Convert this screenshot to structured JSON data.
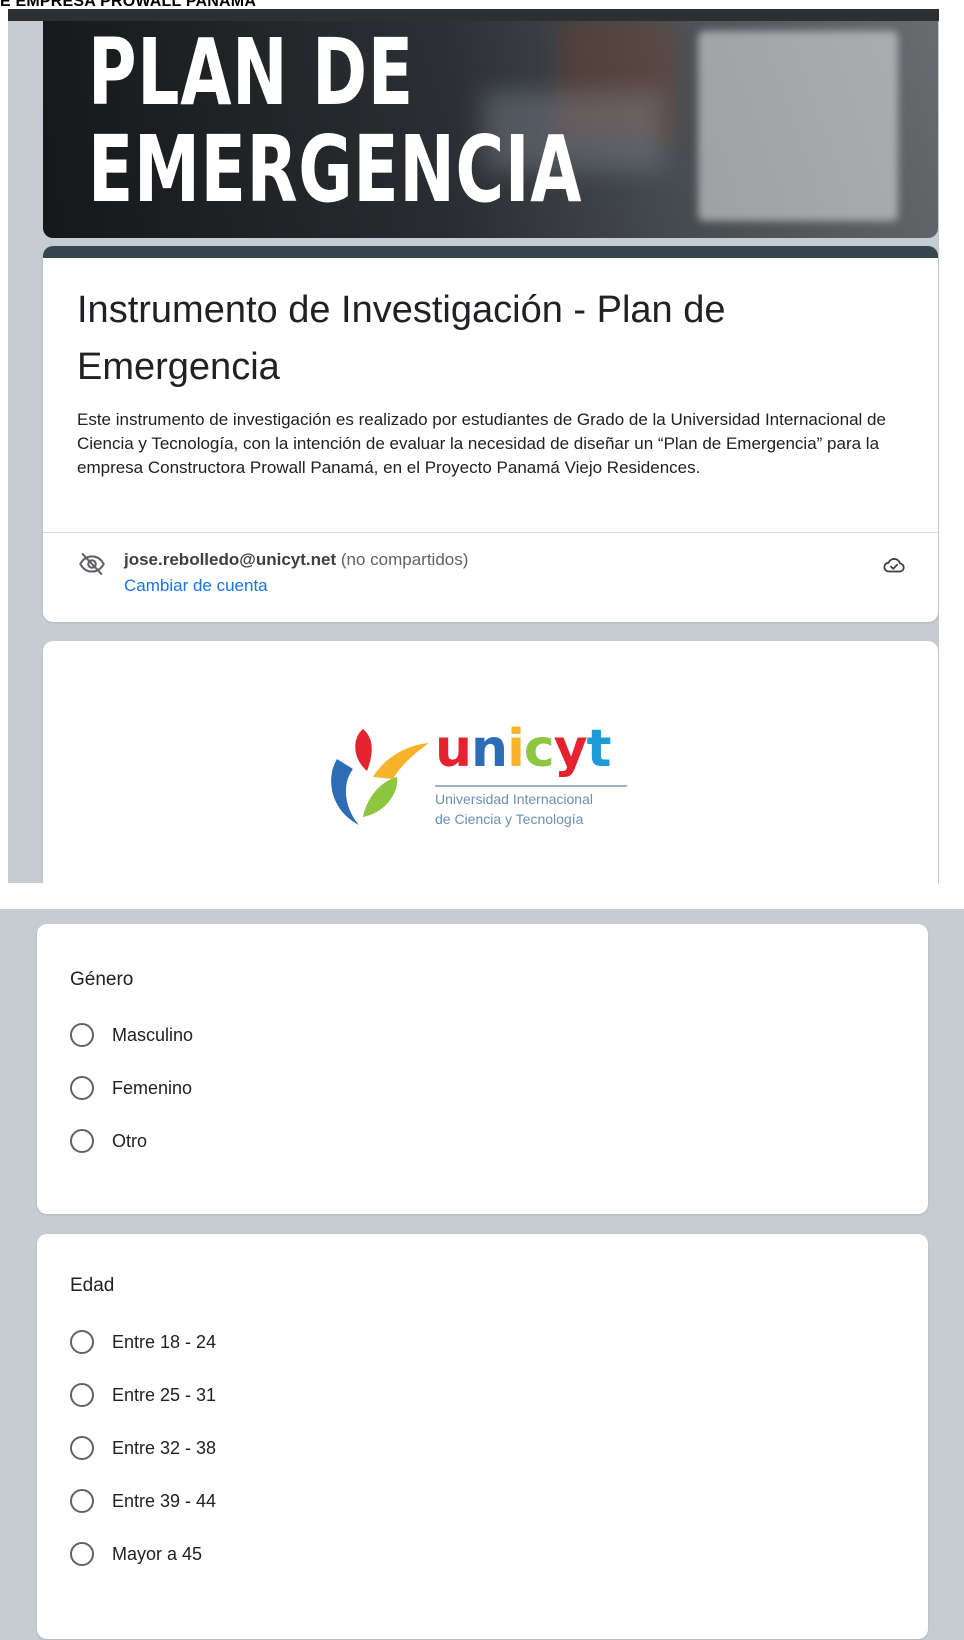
{
  "page_caption": "E EMPRESA PROWALL PANAMÁ",
  "banner": {
    "line1": "PLAN DE",
    "line2": "EMERGENCIA"
  },
  "form": {
    "title": "Instrumento de Investigación - Plan de Emergencia",
    "description": "Este instrumento de investigación es realizado por estudiantes de Grado de la Universidad Internacional de Ciencia y Tecnología, con la intención de evaluar la necesidad de diseñar un “Plan de Emergencia” para la empresa Constructora Prowall Panamá, en el Proyecto Panamá Viejo Residences.",
    "account_email": "jose.rebolledo@unicyt.net",
    "account_note": "(no compartidos)",
    "switch_account_label": "Cambiar de cuenta"
  },
  "logo": {
    "word_letters": [
      "u",
      "n",
      "i",
      "c",
      "y",
      "t"
    ],
    "subtitle_line1": "Universidad Internacional",
    "subtitle_line2": "de Ciencia y Tecnología"
  },
  "questions": {
    "gender": {
      "title": "Género",
      "options": [
        "Masculino",
        "Femenino",
        "Otro"
      ]
    },
    "age": {
      "title": "Edad",
      "options": [
        "Entre 18 - 24",
        "Entre 25 - 31",
        "Entre 32 - 38",
        "Entre 39 - 44",
        "Mayor a 45"
      ]
    }
  },
  "colors": {
    "header_bar": "#37474f",
    "page_background": "#c5cdd3",
    "link": "#1a73e8",
    "radio_border": "#5f6368"
  },
  "icons": {
    "visibility": "visibility-off-icon",
    "cloud": "cloud-done-icon"
  }
}
